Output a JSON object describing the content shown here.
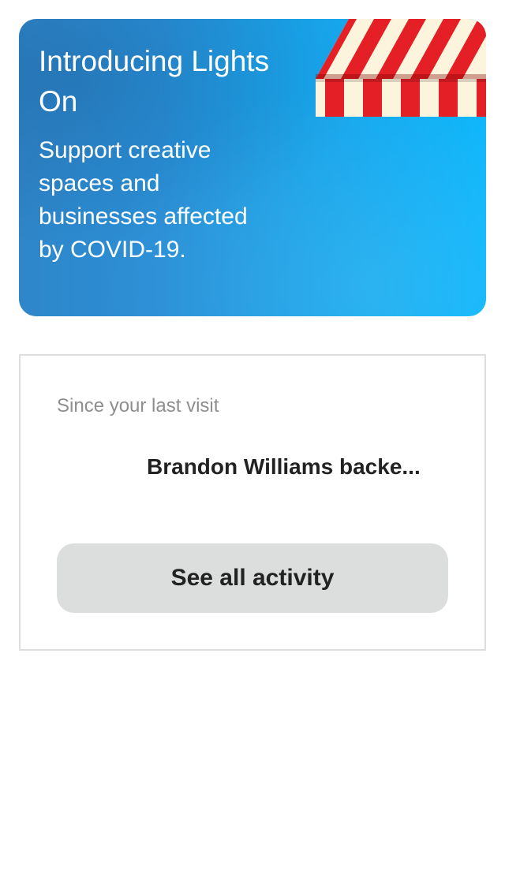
{
  "promo": {
    "title": "Introducing Lights On",
    "subtitle": "Support creative spaces and businesses affected by COVID-19.",
    "awning_colors": [
      "#e41f26",
      "#fdf4dd"
    ]
  },
  "activity": {
    "section_label": "Since your last visit",
    "items": [
      {
        "text": "Brandon Williams backe..."
      }
    ],
    "see_all_label": "See all activity"
  }
}
